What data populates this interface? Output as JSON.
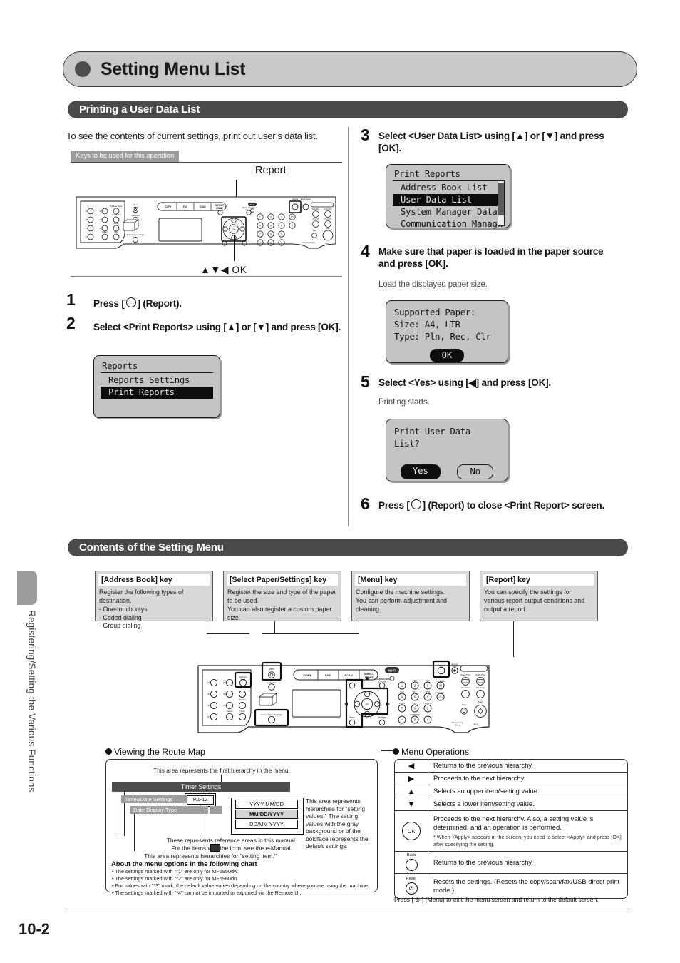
{
  "page": {
    "title": "Setting Menu List",
    "page_number": "10-2",
    "side_tab_text": "Registering/Setting the Various Functions"
  },
  "sections": {
    "printing": {
      "heading": "Printing a User Data List",
      "intro": "To see the contents of current settings, print out user’s data list.",
      "keys_label": "Keys to be used for this operation",
      "callout_report": "Report",
      "callout_ok": "▲▼◀ OK"
    },
    "contents": {
      "heading": "Contents of the Setting Menu"
    }
  },
  "steps": [
    {
      "num": "1",
      "text_before": "Press [",
      "icon": "report-key-circle-icon",
      "text_after": "] (Report)."
    },
    {
      "num": "2",
      "text": "Select <Print Reports> using [▲] or [▼] and press [OK]."
    },
    {
      "num": "3",
      "text": "Select <User Data List> using [▲] or [▼] and press [OK]."
    },
    {
      "num": "4",
      "text": "Make sure that paper is loaded in the paper source and press [OK].",
      "sub": "Load the displayed paper size."
    },
    {
      "num": "5",
      "text": "Select <Yes> using [◀] and press [OK].",
      "sub": "Printing starts."
    },
    {
      "num": "6",
      "text_before": "Press [",
      "icon": "report-key-circle-icon",
      "text_after": "] (Report) to close <Print Report> screen."
    }
  ],
  "lcd_screens": {
    "reports": {
      "title": "Reports",
      "items": [
        {
          "label": "Reports Settings",
          "selected": false
        },
        {
          "label": "Print Reports",
          "selected": true
        }
      ]
    },
    "print_reports": {
      "title": "Print Reports",
      "items": [
        {
          "label": "Address Book List",
          "selected": false
        },
        {
          "label": "User Data List",
          "selected": true
        },
        {
          "label": "System Manager Data…",
          "selected": false
        },
        {
          "label": "Communication Manag…",
          "selected": false
        }
      ],
      "scrollbar": true
    },
    "supported_paper": {
      "line1": "Supported Paper:",
      "line2": "Size: A4, LTR",
      "line3": "Type: Pln, Rec, Clr",
      "button_ok": "OK"
    },
    "confirm_print": {
      "line1": "Print User Data",
      "line2": "List?",
      "button_yes": "Yes",
      "button_no": "No"
    }
  },
  "key_callouts": [
    {
      "title": "[Address Book] key",
      "body": "Register the following types of destination.\n- One-touch keys\n- Coded dialing\n- Group dialing"
    },
    {
      "title": "[Select Paper/Settings] key",
      "body": "Register the size and type of the paper to be used.\nYou can also register a custom paper size."
    },
    {
      "title": "[Menu] key",
      "body": "Configure the machine settings.\nYou can perform adjustment and cleaning."
    },
    {
      "title": "[Report] key",
      "body": "You can specify the settings for various report output conditions and output a report."
    }
  ],
  "route_map": {
    "heading": "Viewing the Route Map",
    "caption_top": "This area represents the first hierarchy in the menu.",
    "bar_first_hierarchy": "Timer Settings",
    "bar_setting_item_1": "Time&Date Settings",
    "bar_setting_item_2": "Date Display Type",
    "reference_page": "P.1-12",
    "values": [
      {
        "label": "YYYY MM/DD",
        "default": false
      },
      {
        "label": "MM/DD/YYYY",
        "default": true
      },
      {
        "label": "DD/MM YYYY",
        "default": false
      }
    ],
    "caption_values": "This area represents hierarchies for \"setting values.\" The setting values with the gray background or of the boldface represents the default settings.",
    "caption_reference": "These represents reference areas in this manual.",
    "caption_emanual": "For the items with the        icon, see the e-Manual.",
    "caption_setting_item": "This area represents hierarchies for \"setting item.\"",
    "about_title": "About the menu options in the following chart",
    "about_items": [
      "• The settings marked with \"*1\" are only for MF5950dw.",
      "• The settings marked with \"*2\" are only for MF5960dn.",
      "• For values with \"*3\" mark, the default value varies depending on the country where you are using the machine.",
      "• The settings marked with \"*4\" cannot be imported or exported via the Remote UI."
    ]
  },
  "menu_operations": {
    "heading": "Menu Operations",
    "rows": [
      {
        "key_icon": "◀",
        "key_label": "",
        "desc": "Returns to the previous hierarchy.",
        "note": ""
      },
      {
        "key_icon": "▶",
        "key_label": "",
        "desc": "Proceeds to the next hierarchy.",
        "note": ""
      },
      {
        "key_icon": "▲",
        "key_label": "",
        "desc": "Selects an upper item/setting value.",
        "note": ""
      },
      {
        "key_icon": "▼",
        "key_label": "",
        "desc": "Selects a lower item/setting value.",
        "note": ""
      },
      {
        "key_icon": "OK",
        "key_label": "",
        "desc": "Proceeds to the next hierarchy. Also, a setting value is determined, and an operation is performed.",
        "note": "* When <Apply> appears in the screen, you need to select <Apply> and press [OK] after specifying the setting."
      },
      {
        "key_icon": "○",
        "key_label": "Back",
        "desc": "Returns to the previous hierarchy.",
        "note": ""
      },
      {
        "key_icon": "⊘",
        "key_label": "Reset",
        "desc": "Resets the settings. (Resets the copy/scan/fax/USB direct print mode.)",
        "note": ""
      }
    ],
    "footer": "Press [ ⊛ ] (Menu) to exit the menu screen and return to the default screen."
  },
  "panel_labels": {
    "mode_keys": [
      "COPY",
      "FAX",
      "SCAN",
      "DIRECT PRINT"
    ],
    "menu": "Menu",
    "address_book": "Address Book",
    "coded_dial": "Coded Dial",
    "redial": "Redial",
    "pause": "Pause",
    "hook": "Hook",
    "select_paper_settings": "Select Paper/Settings",
    "reset": "Reset",
    "status_monitor_cancel": "Status Monitor/Cancel",
    "back": "Back",
    "settings": "Settings",
    "ok": "OK",
    "report": "Report",
    "energy_saver": "Energy Saver",
    "wifi": "Wi-Fi",
    "id": "ID",
    "clear": "C",
    "tone": "Tone",
    "stop": "Stop",
    "start": "Start",
    "processing_data": "Processing/Data",
    "error": "Error",
    "scan_pc1": "Scan-PC1",
    "scan_pc2": "Scan-PC2",
    "pc_print": "PC Print",
    "pc_copy": "PC Copy"
  },
  "colors": {
    "banner_bg": "#c9c9c9",
    "section_bar_bg": "#4a4a4a",
    "lcd_bg": "#c4c4c4",
    "callout_bg": "#d8d8d8",
    "accent_dark": "#1a1a1a"
  }
}
